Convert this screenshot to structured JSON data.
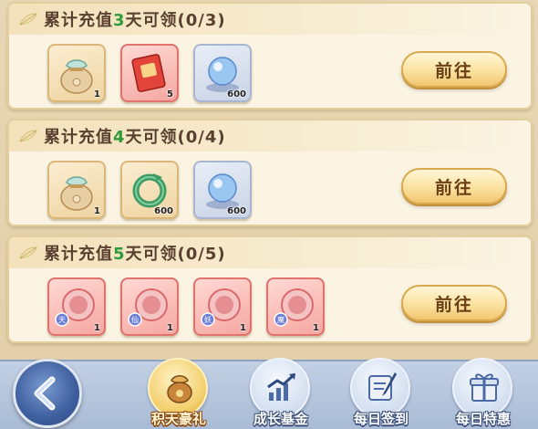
{
  "tasks": [
    {
      "title_prefix": "累计充值",
      "days": "3",
      "title_suffix": "天可领",
      "progress": "(0/3)",
      "button_label": "前往",
      "rewards": [
        {
          "icon": "pouch-icon",
          "quality": "gold",
          "count": "1"
        },
        {
          "icon": "red-envelope-icon",
          "quality": "red",
          "count": "5"
        },
        {
          "icon": "crystal-orb-icon",
          "quality": "blue",
          "count": "600"
        }
      ]
    },
    {
      "title_prefix": "累计充值",
      "days": "4",
      "title_suffix": "天可领",
      "progress": "(0/4)",
      "button_label": "前往",
      "rewards": [
        {
          "icon": "pouch-icon",
          "quality": "gold",
          "count": "1"
        },
        {
          "icon": "jade-dragon-icon",
          "quality": "gold",
          "count": "600"
        },
        {
          "icon": "crystal-orb-icon",
          "quality": "blue",
          "count": "600"
        }
      ]
    },
    {
      "title_prefix": "累计充值",
      "days": "5",
      "title_suffix": "天可领",
      "progress": "(0/5)",
      "button_label": "前往",
      "rewards": [
        {
          "icon": "avatar-frame-icon",
          "quality": "red",
          "count": "1",
          "tag": "天"
        },
        {
          "icon": "avatar-frame-icon",
          "quality": "red",
          "count": "1",
          "tag": "仙"
        },
        {
          "icon": "avatar-frame-icon",
          "quality": "red",
          "count": "1",
          "tag": "妖"
        },
        {
          "icon": "avatar-frame-icon",
          "quality": "red",
          "count": "1",
          "tag": "魔"
        }
      ]
    }
  ],
  "nav": {
    "back_icon": "chevron-left-icon",
    "items": [
      {
        "label": "积天豪礼",
        "icon": "gift-bag-icon",
        "active": true
      },
      {
        "label": "成长基金",
        "icon": "growth-chart-icon",
        "active": false
      },
      {
        "label": "每日签到",
        "icon": "scroll-brush-icon",
        "active": false
      },
      {
        "label": "每日特惠",
        "icon": "gift-box-icon",
        "active": false
      }
    ]
  },
  "colors": {
    "day_number": "#2e9a3a",
    "title_text": "#5a4030",
    "button_text": "#6a3e16"
  }
}
